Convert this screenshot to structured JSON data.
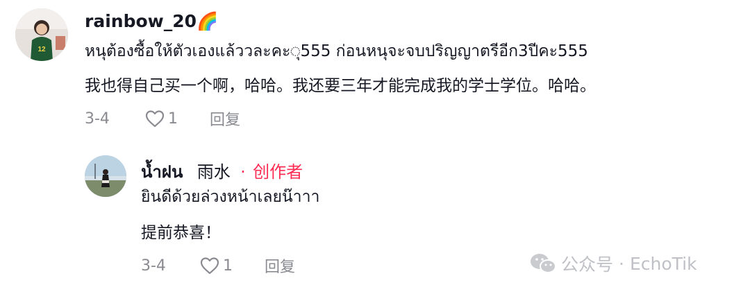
{
  "comments": [
    {
      "username": "rainbow_20",
      "username_emoji": "🌈",
      "text_thai": "หนุต้องซื้อให้ตัวเองแล้ววละคะ◌ุ555 ก่อนหนุจะจบปริญญาตรีอีก3ปีคะ555",
      "text_translation": "我也得自己买一个啊，哈哈。我还要三年才能完成我的学士学位。哈哈。",
      "date": "3-4",
      "likes": "1",
      "reply_label": "回复"
    }
  ],
  "reply": {
    "username": "น้ำฝน",
    "username_translation": "雨水",
    "separator": "·",
    "creator_label": "创作者",
    "text_thai": "ยินดีด้วยล่วงหน้าเลยน๊าาา",
    "text_translation": "提前恭喜！",
    "date": "3-4",
    "likes": "1",
    "reply_label": "回复"
  },
  "watermark": {
    "platform": "公众号",
    "separator": "·",
    "account": "EchoTik"
  },
  "colors": {
    "creator": "#fe2c55",
    "meta": "#8a8b91",
    "watermark": "#bfc1c6"
  }
}
